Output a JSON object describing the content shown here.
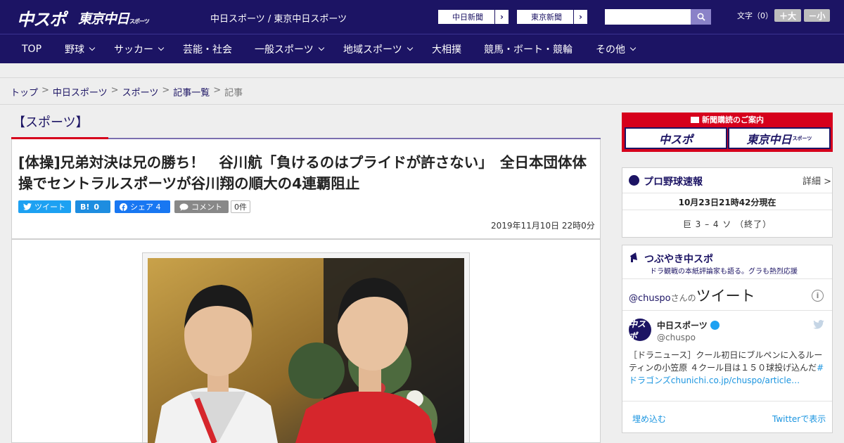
{
  "header": {
    "logo_main": "中スポ",
    "logo_tokyo": "東京中日",
    "logo_tokyo_small": "スポーツ",
    "site_link": "中日スポーツ / 東京中日スポーツ",
    "newspaper_buttons": [
      "中日新聞",
      "東京新聞"
    ],
    "search_placeholder": "",
    "font_size_label": "文字（0）",
    "font_increase": "＋大",
    "font_decrease": "－小"
  },
  "nav": {
    "items": [
      {
        "label": "TOP",
        "dropdown": false
      },
      {
        "label": "野球",
        "dropdown": true
      },
      {
        "label": "サッカー",
        "dropdown": true
      },
      {
        "label": "芸能・社会",
        "dropdown": false
      },
      {
        "label": "一般スポーツ",
        "dropdown": true
      },
      {
        "label": "地域スポーツ",
        "dropdown": true
      },
      {
        "label": "大相撲",
        "dropdown": false
      },
      {
        "label": "競馬・ボート・競輪",
        "dropdown": false
      },
      {
        "label": "その他",
        "dropdown": true
      }
    ]
  },
  "breadcrumb": {
    "links": [
      "トップ",
      "中日スポーツ",
      "スポーツ",
      "記事一覧"
    ],
    "current": "記事",
    "separator": ">"
  },
  "article": {
    "section": "【スポーツ】",
    "title": "[体操]兄弟対決は兄の勝ち！　谷川航「負けるのはプライドが許さない」　全日本団体体操でセントラルスポーツが谷川翔の順大の4連覇阻止",
    "share": {
      "tweet": "ツイート",
      "hatena": "0",
      "facebook": "シェア 4",
      "comment": "コメント",
      "comment_count": "0件"
    },
    "date": "2019年11月10日 22時0分"
  },
  "sidebar": {
    "subscribe_title": "新聞購読のご案内",
    "subscribe_cards": [
      "中スポ",
      "東京中日"
    ],
    "subscribe_card_small": "スポーツ",
    "baseball": {
      "title": "プロ野球速報",
      "detail": "詳細 >",
      "time": "10月23日21時42分現在",
      "score": "巨 3 – 4 ソ （終了）"
    },
    "tweets": {
      "title": "つぶやき中スポ",
      "subtitle": "ドラ観戦の本紙評論家も語る。グラも熱烈応援",
      "handle": "@chuspo",
      "handle_suffix": "さんの",
      "heading": "ツイート",
      "avatar_text": "中スポ",
      "name": "中日スポーツ",
      "at": "@chuspo",
      "text": "［ドラニュース］クール初日にブルペンに入るルーティンの小笠原 ４クール目は１５０球投げ込んだ",
      "text_link": "#ドラゴンズ",
      "text_url": "chunichi.co.jp/chuspo/article…",
      "embed": "埋め込む",
      "view_on_twitter": "Twitterで表示"
    }
  }
}
